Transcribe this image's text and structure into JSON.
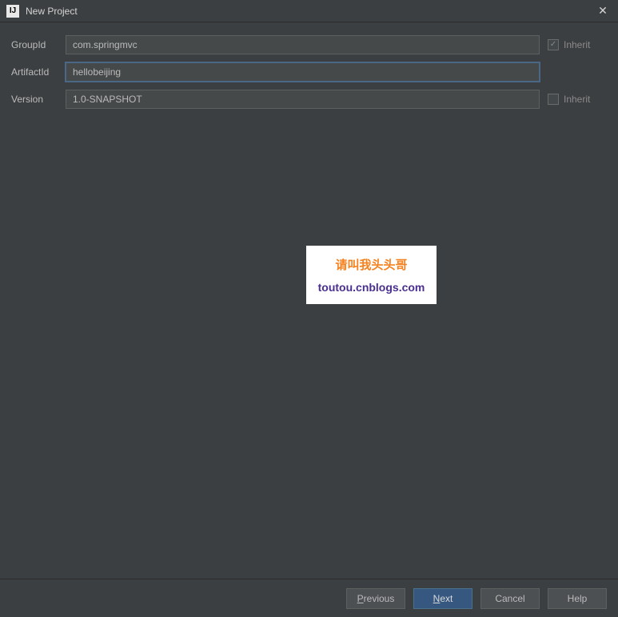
{
  "titlebar": {
    "icon_text": "IJ",
    "title": "New Project",
    "close_glyph": "✕"
  },
  "form": {
    "group_id": {
      "label": "GroupId",
      "value": "com.springmvc",
      "inherit_label": "Inherit"
    },
    "artifact_id": {
      "label": "ArtifactId",
      "value": "hellobeijing"
    },
    "version": {
      "label": "Version",
      "value": "1.0-SNAPSHOT",
      "inherit_label": "Inherit"
    }
  },
  "watermark": {
    "line1": "请叫我头头哥",
    "line2": "toutou.cnblogs.com"
  },
  "footer": {
    "previous_prefix": "P",
    "previous_rest": "revious",
    "next_prefix": "N",
    "next_rest": "ext",
    "cancel": "Cancel",
    "help": "Help"
  }
}
